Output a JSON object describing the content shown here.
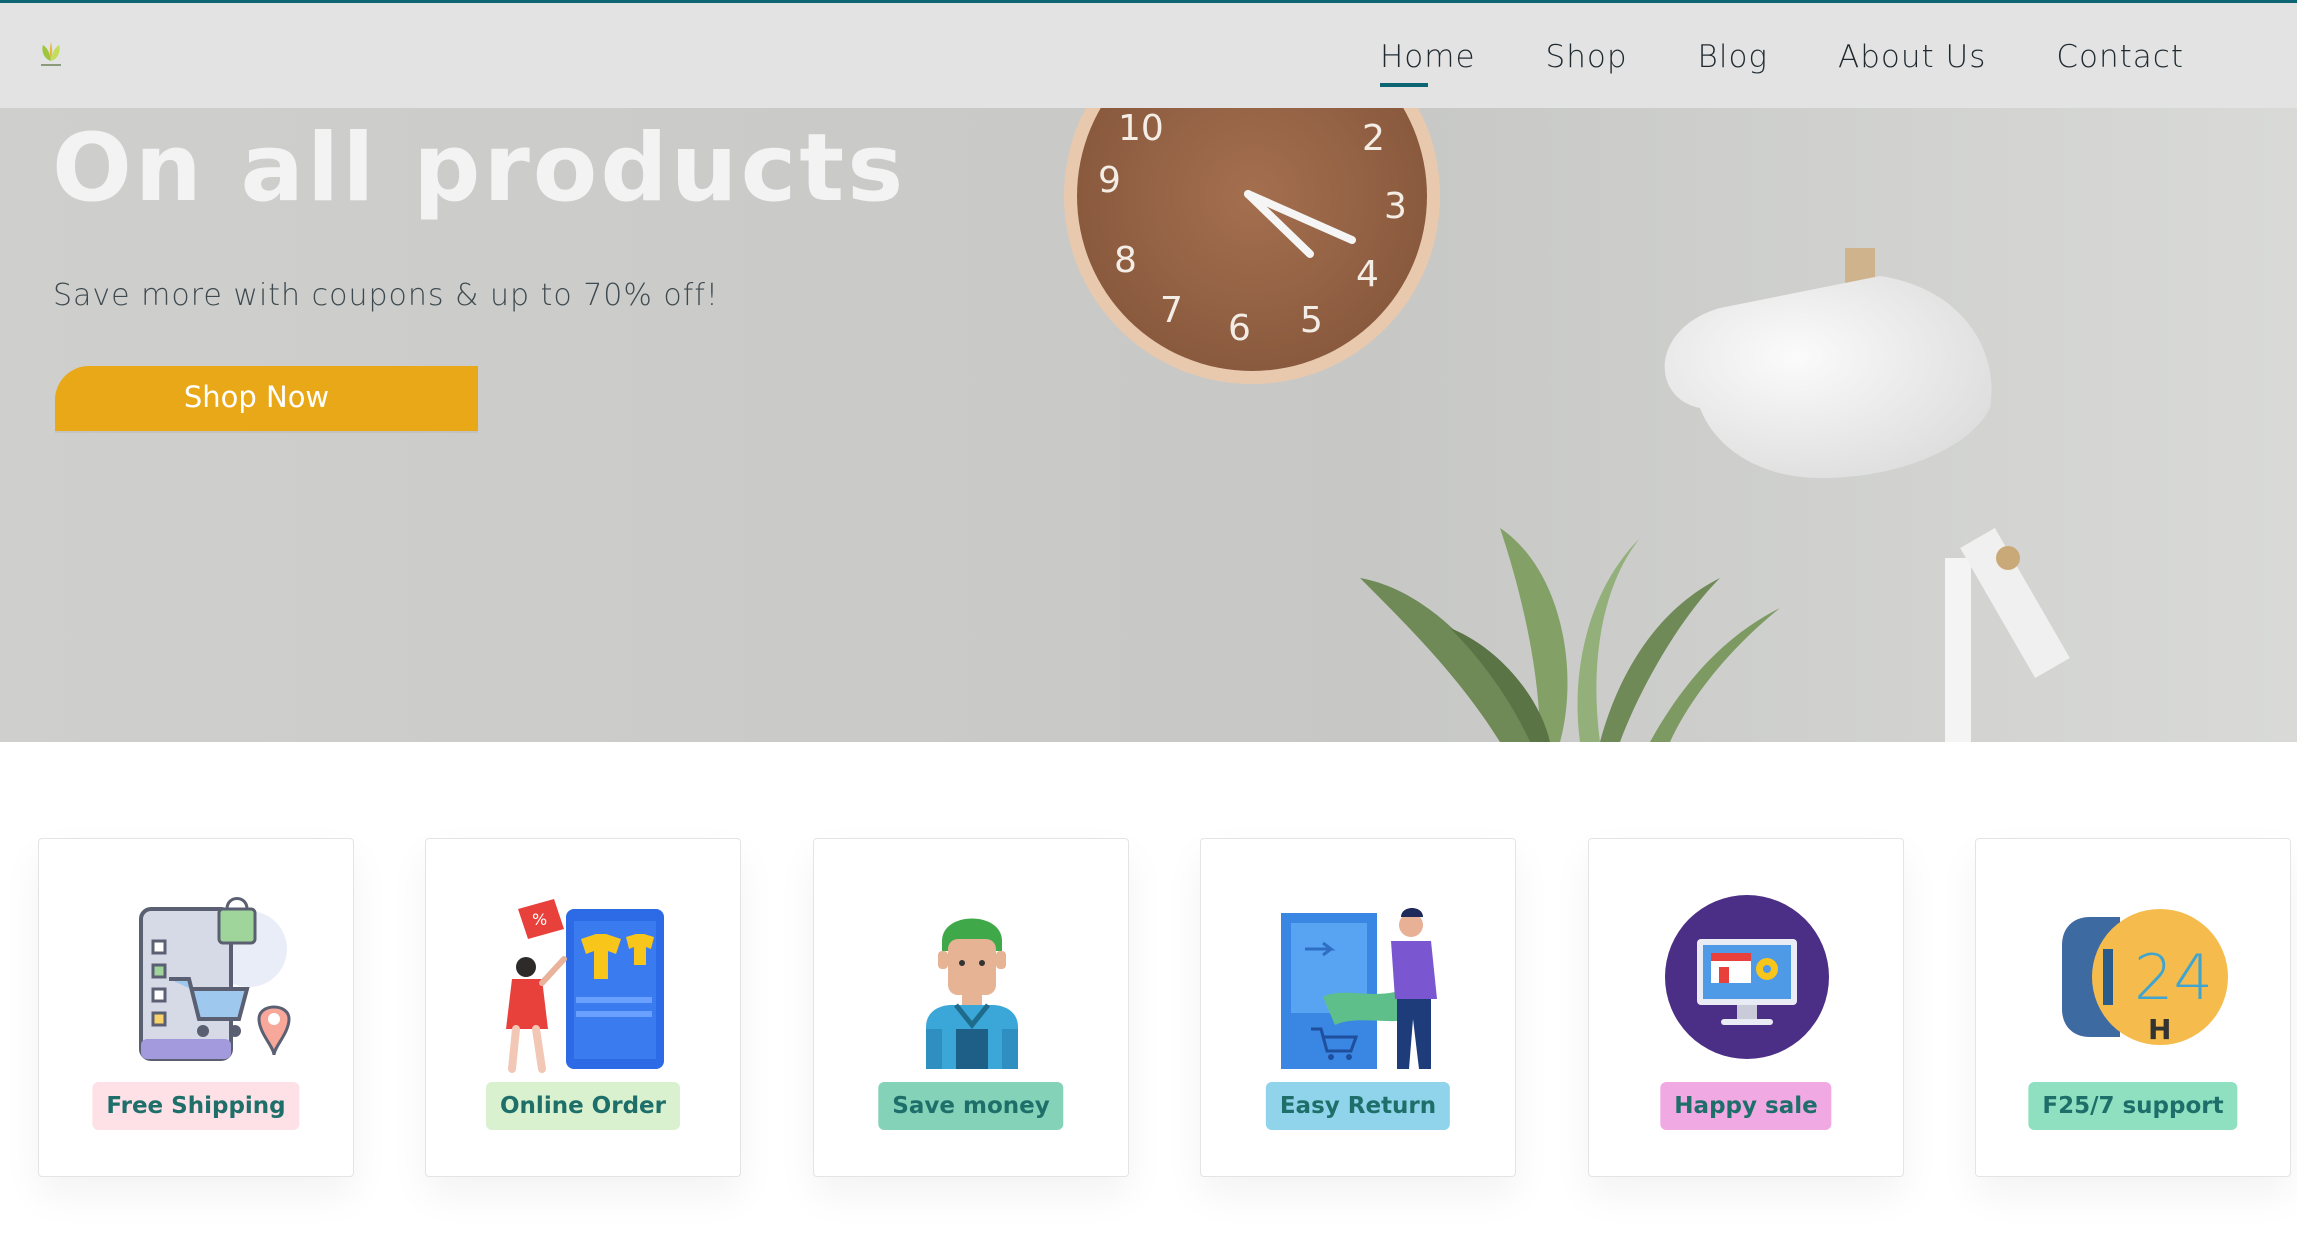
{
  "header": {
    "logo_icon": "leaf-logo-icon",
    "nav": [
      {
        "label": "Home",
        "active": true
      },
      {
        "label": "Shop",
        "active": false
      },
      {
        "label": "Blog",
        "active": false
      },
      {
        "label": "About Us",
        "active": false
      },
      {
        "label": "Contact",
        "active": false
      }
    ],
    "accent_color": "#0d6472"
  },
  "hero": {
    "title": "On all products",
    "subtitle": "Save more with coupons & up to 70% off!",
    "button_label": "Shop Now",
    "button_color": "#e8a818",
    "clock_numbers": [
      "10",
      "2",
      "9",
      "3",
      "8",
      "4",
      "7",
      "6",
      "5"
    ]
  },
  "features": [
    {
      "label": "Free Shipping",
      "icon": "shopping-cart-phone-icon",
      "badge_color": "#fde1e6"
    },
    {
      "label": "Online Order",
      "icon": "online-shopping-icon",
      "badge_color": "#d9f1cf"
    },
    {
      "label": "Save money",
      "icon": "person-icon",
      "badge_color": "#84d2b8"
    },
    {
      "label": "Easy Return",
      "icon": "return-delivery-icon",
      "badge_color": "#8fd4ea"
    },
    {
      "label": "Happy sale",
      "icon": "monitor-store-icon",
      "badge_color": "#f1a9e4"
    },
    {
      "label": "F25/7 support",
      "icon": "support-24h-icon",
      "badge_color": "#8ee0c0"
    }
  ]
}
